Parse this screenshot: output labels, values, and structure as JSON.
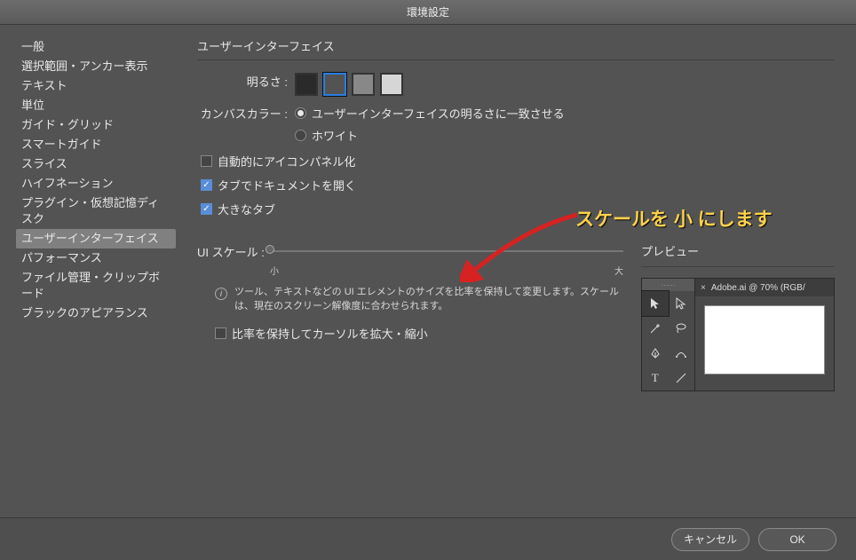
{
  "window": {
    "title": "環境設定"
  },
  "sidebar": {
    "items": [
      {
        "label": "一般"
      },
      {
        "label": "選択範囲・アンカー表示"
      },
      {
        "label": "テキスト"
      },
      {
        "label": "単位"
      },
      {
        "label": "ガイド・グリッド"
      },
      {
        "label": "スマートガイド"
      },
      {
        "label": "スライス"
      },
      {
        "label": "ハイフネーション"
      },
      {
        "label": "プラグイン・仮想記憶ディスク"
      },
      {
        "label": "ユーザーインターフェイス",
        "selected": true
      },
      {
        "label": "パフォーマンス"
      },
      {
        "label": "ファイル管理・クリップボード"
      },
      {
        "label": "ブラックのアピアランス"
      }
    ]
  },
  "main": {
    "section_title": "ユーザーインターフェイス",
    "brightness_label": "明るさ :",
    "brightness_swatches": [
      {
        "color": "#2a2a2a",
        "selected": false
      },
      {
        "color": "#535353",
        "selected": true
      },
      {
        "color": "#888888",
        "selected": false
      },
      {
        "color": "#d6d6d6",
        "selected": false
      }
    ],
    "canvas_color_label": "カンバスカラー :",
    "canvas_color_options": [
      {
        "label": "ユーザーインターフェイスの明るさに一致させる",
        "checked": true
      },
      {
        "label": "ホワイト",
        "checked": false
      }
    ],
    "checkboxes": [
      {
        "label": "自動的にアイコンパネル化",
        "checked": false
      },
      {
        "label": "タブでドキュメントを開く",
        "checked": true
      },
      {
        "label": "大きなタブ",
        "checked": true
      }
    ],
    "ui_scale_label": "UI スケール :",
    "scale_min": "小",
    "scale_max": "大",
    "info_text": "ツール、テキストなどの UI エレメントのサイズを比率を保持して変更します。スケールは、現在のスクリーン解像度に合わせられます。",
    "cursor_checkbox": {
      "label": "比率を保持してカーソルを拡大・縮小",
      "checked": false
    },
    "preview_title": "プレビュー",
    "doc_tab": "Adobe.ai @ 70% (RGB/"
  },
  "annotation": {
    "text": "スケールを 小 にします"
  },
  "footer": {
    "cancel": "キャンセル",
    "ok": "OK"
  }
}
